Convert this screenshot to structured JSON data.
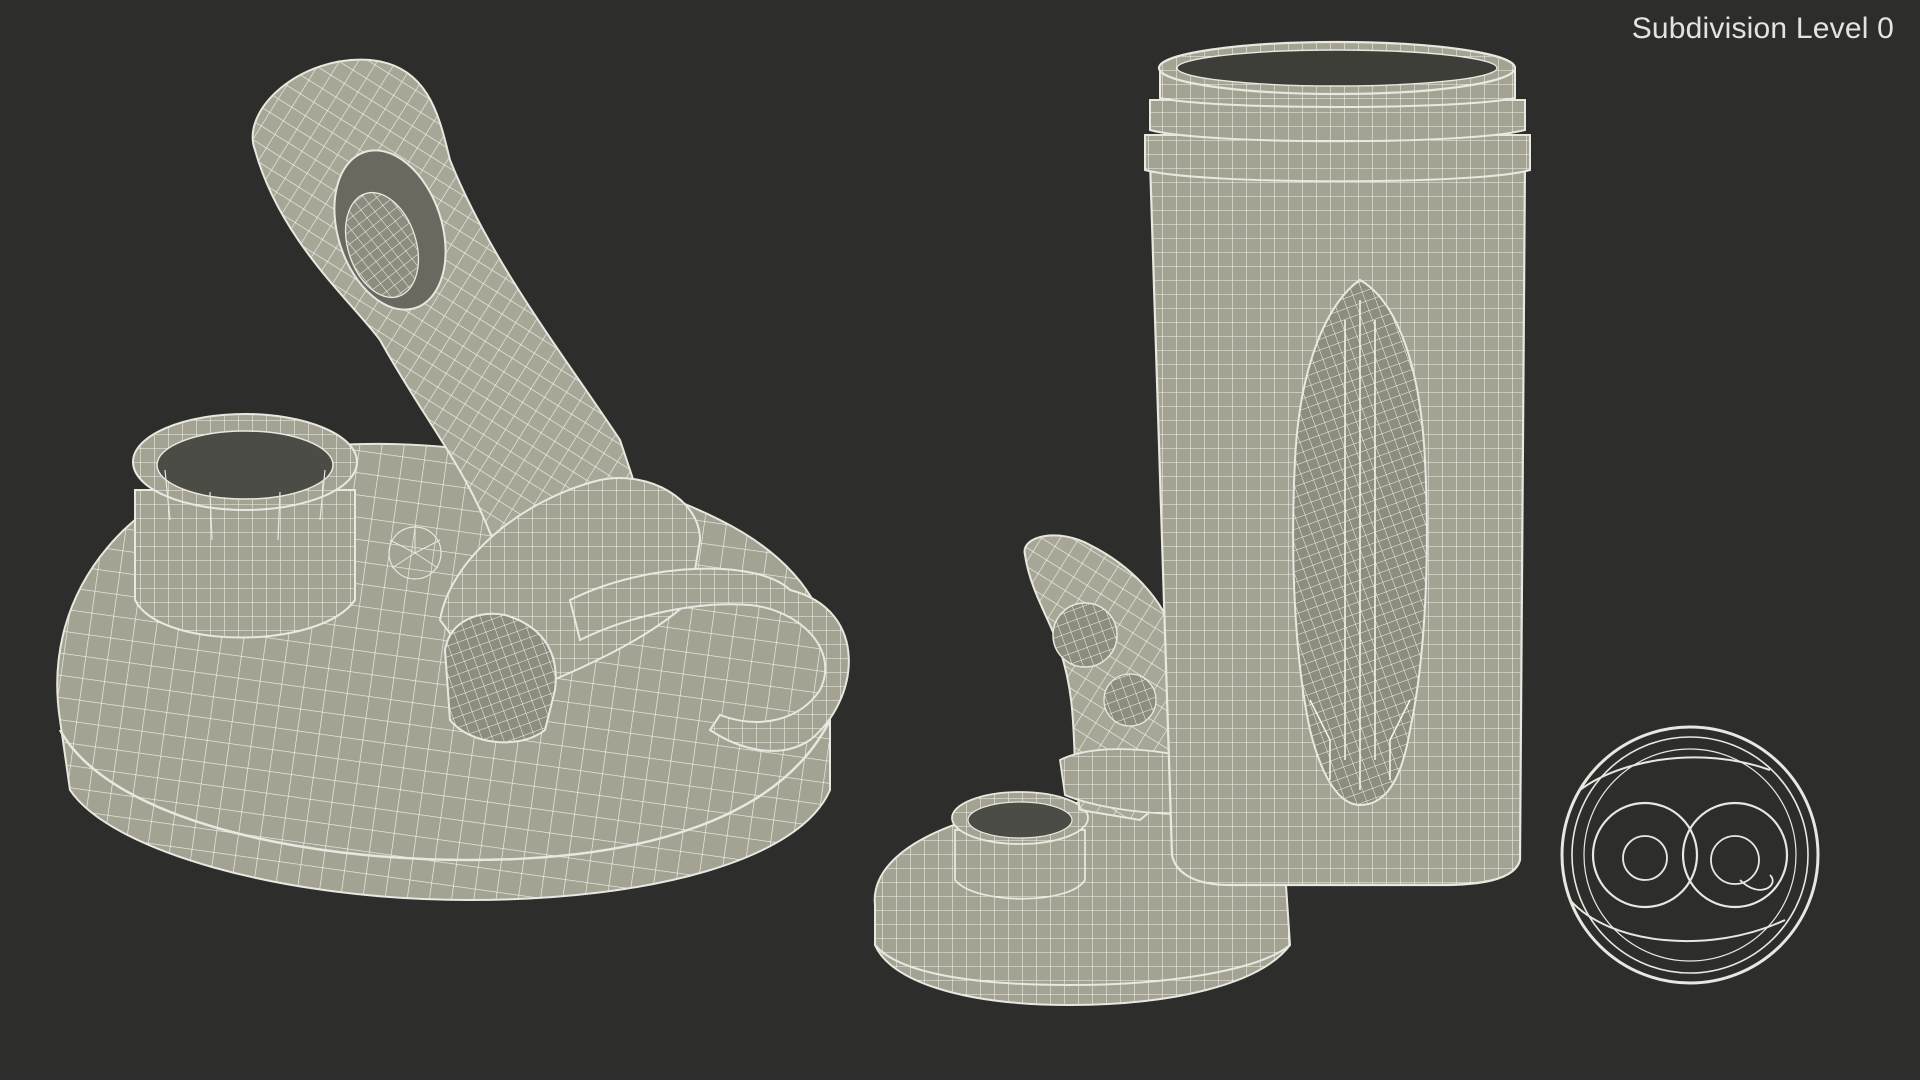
{
  "render": {
    "caption": "Subdivision Level 0",
    "background_color": "#2d2d2b",
    "model_fill_color": "#a3a293",
    "wire_color": "#f2f2ea"
  },
  "objects": [
    {
      "name": "large-lid",
      "icon": "flip-cap-lid"
    },
    {
      "name": "small-lid",
      "icon": "flip-cap-lid"
    },
    {
      "name": "shaker-bottle",
      "icon": "bottle"
    },
    {
      "name": "whisk-ball",
      "icon": "wire-ball"
    }
  ]
}
